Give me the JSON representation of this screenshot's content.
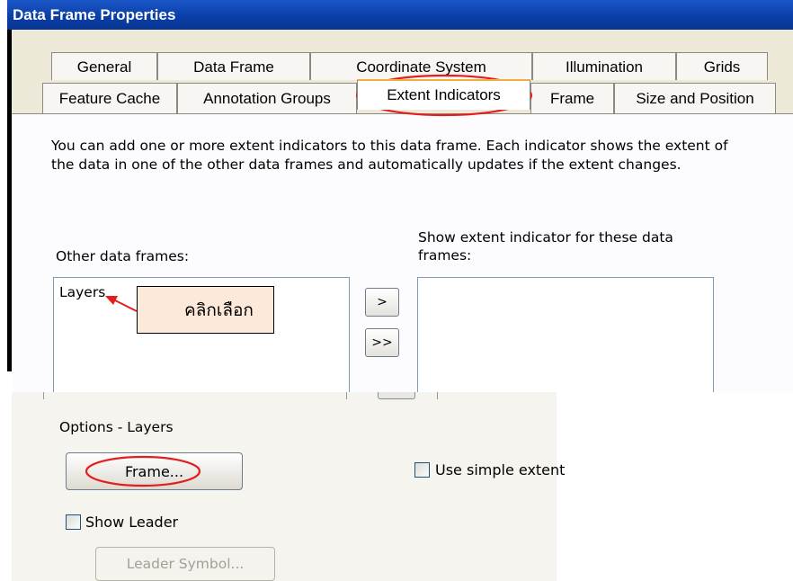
{
  "window": {
    "title": "Data Frame Properties"
  },
  "tabs": {
    "row1": [
      "General",
      "Data Frame",
      "Coordinate System",
      "Illumination",
      "Grids"
    ],
    "row2": [
      "Feature Cache",
      "Annotation Groups",
      "Extent Indicators",
      "Frame",
      "Size and Position"
    ],
    "active": "Extent Indicators"
  },
  "content": {
    "description": "You can add one or more extent indicators to this data frame.  Each indicator shows the extent of the data in one of the other data frames and automatically updates if the extent changes.",
    "other_frames_label": "Other data frames:",
    "other_frames_items": [
      "Layers"
    ],
    "show_label": "Show extent indicator for these data frames:",
    "add_button": ">",
    "add_all_button": ">>"
  },
  "callout": {
    "text": "คลิกเลือก"
  },
  "options": {
    "group_label": "Options - Layers",
    "frame_button": "Frame...",
    "simple_extent_label": "Use simple extent",
    "simple_extent_checked": false,
    "show_leader_label": "Show Leader",
    "show_leader_checked": false,
    "leader_symbol_button": "Leader Symbol..."
  },
  "colors": {
    "titlebar": "#0a3fa8",
    "highlight_circle": "#e31e1e",
    "callout_fill": "#fde9d9"
  }
}
